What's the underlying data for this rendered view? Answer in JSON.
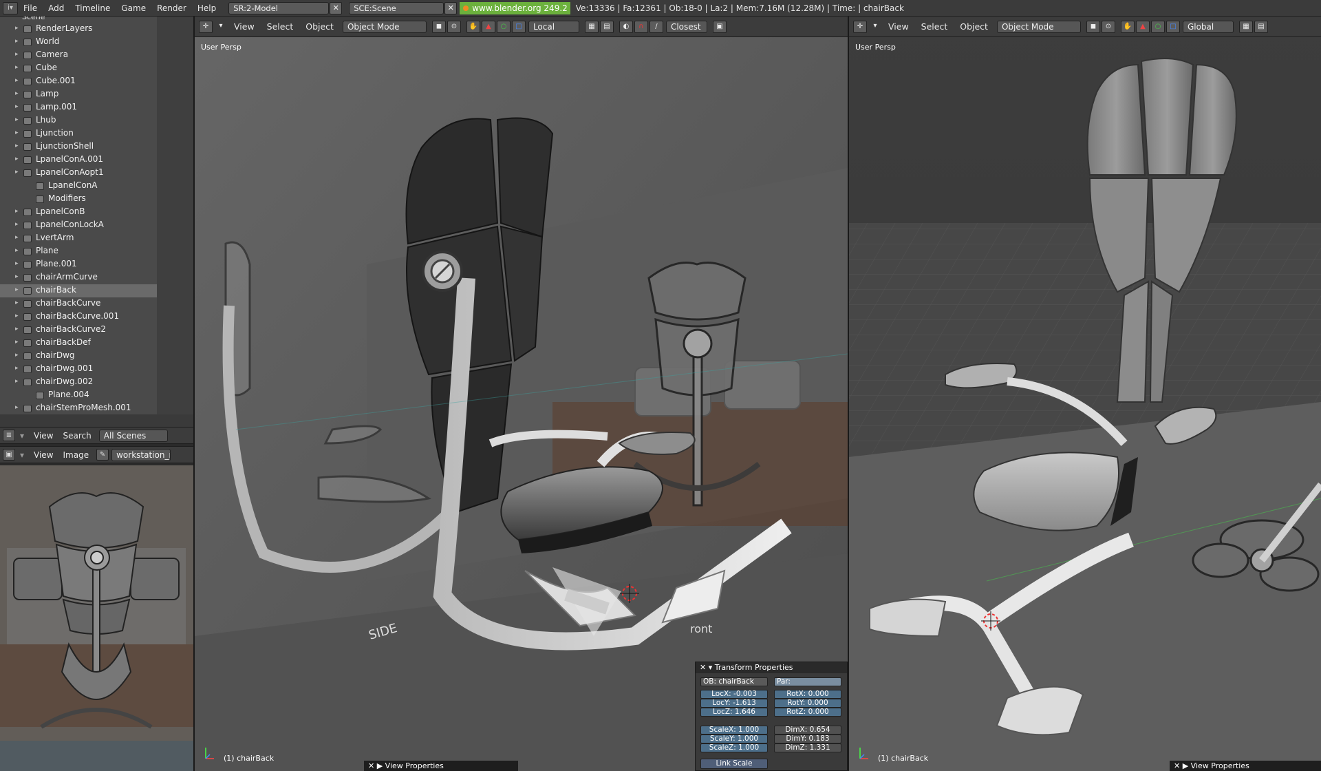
{
  "topbar": {
    "menus": [
      "File",
      "Add",
      "Timeline",
      "Game",
      "Render",
      "Help"
    ],
    "screen_field": "SR:2-Model",
    "scene_field": "SCE:Scene",
    "url": "www.blender.org 249.2",
    "stats": "Ve:13336 | Fa:12361 | Ob:18-0 | La:2  | Mem:7.16M (12.28M)  | Time: | chairBack"
  },
  "outliner": {
    "top_label": "Scene",
    "rows": [
      {
        "label": "RenderLayers",
        "depth": 1
      },
      {
        "label": "World",
        "depth": 1
      },
      {
        "label": "Camera",
        "depth": 1
      },
      {
        "label": "Cube",
        "depth": 1
      },
      {
        "label": "Cube.001",
        "depth": 1
      },
      {
        "label": "Lamp",
        "depth": 1
      },
      {
        "label": "Lamp.001",
        "depth": 1
      },
      {
        "label": "Lhub",
        "depth": 1
      },
      {
        "label": "Ljunction",
        "depth": 1
      },
      {
        "label": "LjunctionShell",
        "depth": 1
      },
      {
        "label": "LpanelConA.001",
        "depth": 1
      },
      {
        "label": "LpanelConAopt1",
        "depth": 1
      },
      {
        "label": "LpanelConA",
        "depth": 2
      },
      {
        "label": "Modifiers",
        "depth": 2
      },
      {
        "label": "LpanelConB",
        "depth": 1
      },
      {
        "label": "LpanelConLockA",
        "depth": 1
      },
      {
        "label": "LvertArm",
        "depth": 1
      },
      {
        "label": "Plane",
        "depth": 1
      },
      {
        "label": "Plane.001",
        "depth": 1
      },
      {
        "label": "chairArmCurve",
        "depth": 1
      },
      {
        "label": "chairBack",
        "depth": 1,
        "selected": true
      },
      {
        "label": "chairBackCurve",
        "depth": 1
      },
      {
        "label": "chairBackCurve.001",
        "depth": 1
      },
      {
        "label": "chairBackCurve2",
        "depth": 1
      },
      {
        "label": "chairBackDef",
        "depth": 1
      },
      {
        "label": "chairDwg",
        "depth": 1
      },
      {
        "label": "chairDwg.001",
        "depth": 1
      },
      {
        "label": "chairDwg.002",
        "depth": 1
      },
      {
        "label": "Plane.004",
        "depth": 2
      },
      {
        "label": "chairStemProMesh.001",
        "depth": 1
      }
    ]
  },
  "outliner_header": {
    "view": "View",
    "search": "Search",
    "scope": "All Scenes"
  },
  "image_header": {
    "view": "View",
    "image": "Image",
    "image_name": "workstation_r"
  },
  "vp_left": {
    "menus": [
      "View",
      "Select",
      "Object"
    ],
    "mode": "Object Mode",
    "orientation": "Local",
    "snap": "Closest",
    "persp": "User Persp",
    "objlabel": "(1) chairBack",
    "viewprops": "View Properties",
    "sketch_side": "SIDE",
    "sketch_front": "ront"
  },
  "vp_right": {
    "menus": [
      "View",
      "Select",
      "Object"
    ],
    "mode": "Object Mode",
    "orientation": "Global",
    "persp": "User Persp",
    "objlabel": "(1) chairBack",
    "viewprops": "View Properties"
  },
  "transform": {
    "title": "Transform Properties",
    "ob": "OB: chairBack",
    "par": "Par:",
    "locx": "LocX: -0.003",
    "locy": "LocY: -1.613",
    "locz": "LocZ: 1.646",
    "rotx": "RotX: 0.000",
    "roty": "RotY: 0.000",
    "rotz": "RotZ: 0.000",
    "scalex": "ScaleX: 1.000",
    "scaley": "ScaleY: 1.000",
    "scalez": "ScaleZ: 1.000",
    "dimx": "DimX: 0.654",
    "dimy": "DimY: 0.183",
    "dimz": "DimZ: 1.331",
    "link_scale": "Link Scale"
  },
  "colors": {
    "url_bg": "#6cb13d",
    "panel": "#4a4a4a",
    "header": "#3c3c3c",
    "selected_row": "#6a6a6a"
  }
}
